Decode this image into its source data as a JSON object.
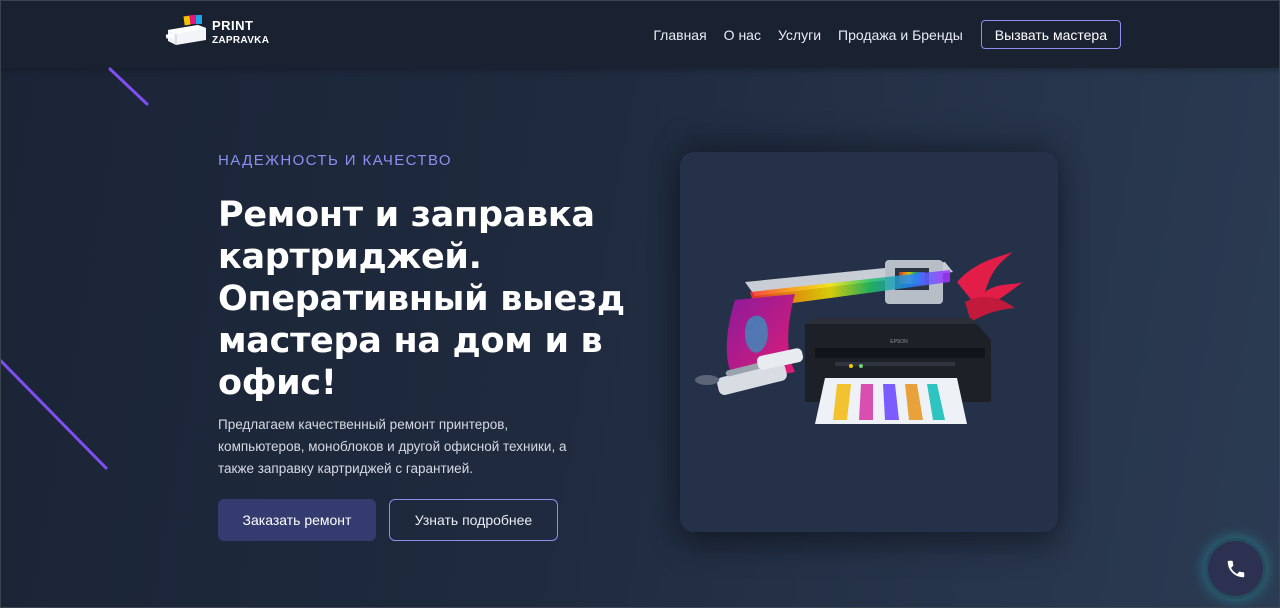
{
  "header": {
    "logo": {
      "line1": "PRINT",
      "line2": "ZAPRAVKA"
    },
    "nav": [
      {
        "label": "Главная"
      },
      {
        "label": "О нас"
      },
      {
        "label": "Услуги"
      },
      {
        "label": "Продажа и Бренды"
      }
    ],
    "cta_label": "Вызвать мастера"
  },
  "hero": {
    "eyebrow": "НАДЕЖНОСТЬ И КАЧЕСТВО",
    "title": "Ремонт и заправка картриджей. Оперативный выезд мастера на дом и в офис!",
    "description": "Предлагаем качественный ремонт принтеров, компьютеров, моноблоков и другой офисной техники, а также заправку картриджей с гарантией.",
    "primary_button": "Заказать ремонт",
    "secondary_button": "Узнать подробнее"
  },
  "illustration": {
    "printer_brand": "EPSON"
  },
  "colors": {
    "accent": "#8a8ff0",
    "header_bg": "#1a2131",
    "primary_button_bg": "#343b6e",
    "card_bg": "#253148",
    "deco_line": "#7f4ff0",
    "phone_glow": "#2bbfc8"
  },
  "icons": {
    "floating_button": "phone-icon"
  }
}
